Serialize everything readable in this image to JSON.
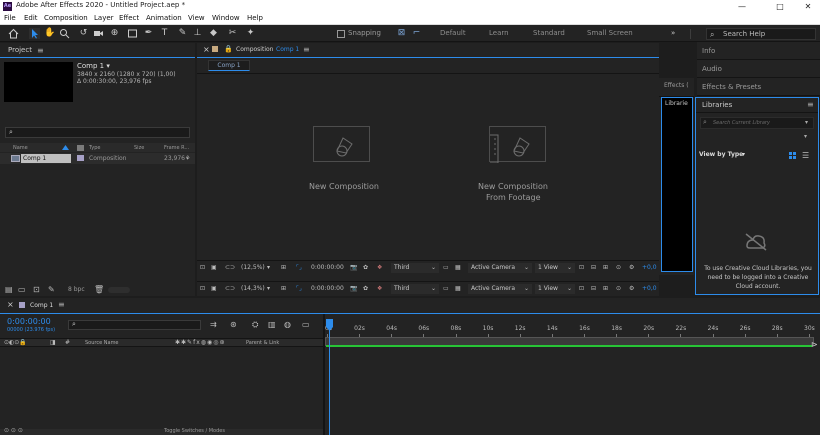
{
  "app": {
    "title": "Adobe After Effects 2020 - Untitled Project.aep *",
    "logo_text": "Ae",
    "window_controls": [
      "—",
      "□",
      "✕"
    ]
  },
  "menu": [
    "File",
    "Edit",
    "Composition",
    "Layer",
    "Effect",
    "Animation",
    "View",
    "Window",
    "Help"
  ],
  "toolbar": {
    "snapping_label": "Snapping",
    "workspaces": [
      "Default",
      "Learn",
      "Standard",
      "Small Screen"
    ],
    "more_icon": "»",
    "search_placeholder": "Search Help"
  },
  "project": {
    "title": "Project",
    "comp_name": "Comp 1 ▾",
    "comp_size": "3840 x 2160  (1280 x 720) (1,00)",
    "comp_duration": "Δ 0:00:30:00, 23,976 fps",
    "columns": [
      "Name",
      "Type",
      "Size",
      "Frame R..."
    ],
    "items": [
      {
        "name": "Comp 1",
        "type": "Composition",
        "size": "",
        "frame_rate": "23,976"
      }
    ],
    "bpc": "8 bpc"
  },
  "composition": {
    "tab_title": "Composition",
    "tab_comp": "Comp 1",
    "sub_tab": "Comp 1",
    "placeholder_new": "New Composition",
    "placeholder_footage_1": "New Composition",
    "placeholder_footage_2": "From Footage"
  },
  "viewer_bars": [
    {
      "zoom": "(12,5%)",
      "time": "0:00:00:00",
      "view": "Third",
      "camera": "Active Camera",
      "views": "1 View",
      "exposure": "+0,0"
    },
    {
      "zoom": "(14,3%)",
      "time": "0:00:00:00",
      "view": "Third",
      "camera": "Active Camera",
      "views": "1 View",
      "exposure": "+0,0"
    }
  ],
  "side_tabs": {
    "effects": "Effects (",
    "libraries_left": "Librarie"
  },
  "right_panels": [
    "Info",
    "Audio",
    "Effects & Presets"
  ],
  "libraries": {
    "title": "Libraries",
    "search_placeholder": "Search Current Library",
    "view_by": "View by Type",
    "message": "To use Creative Cloud Libraries, you need to be logged into a Creative Cloud account."
  },
  "timeline": {
    "tab": "Comp 1",
    "timecode": "0:00:00:00",
    "timecode_sub": "00000 (23.976 fps)",
    "columns": {
      "source": "Source Name",
      "parent": "Parent & Link"
    },
    "ruler": [
      "0s",
      "02s",
      "04s",
      "06s",
      "08s",
      "10s",
      "12s",
      "14s",
      "16s",
      "18s",
      "20s",
      "22s",
      "24s",
      "26s",
      "28s",
      "30s"
    ],
    "toggle_label": "Toggle Switches / Modes"
  },
  "colors": {
    "accent": "#2d8ceb",
    "work_area": "#27c436",
    "comp_label": "#a6a0c6"
  }
}
